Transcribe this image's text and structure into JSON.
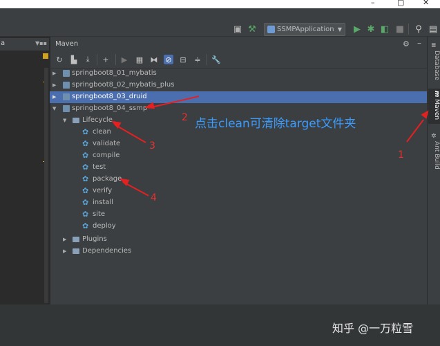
{
  "window": {
    "minimize": "–",
    "restore": "▢",
    "close": "✕"
  },
  "run_toolbar": {
    "config_name": "SSMPApplication",
    "icons": [
      "run-config-icon",
      "build-hammer-icon",
      "run-icon",
      "debug-icon",
      "coverage-icon",
      "stop-icon",
      "search-icon",
      "layout-icon"
    ]
  },
  "editor": {
    "tab_fragment": "a"
  },
  "maven": {
    "title": "Maven",
    "projects": [
      {
        "label": "springboot8_01_mybatis",
        "expanded": false
      },
      {
        "label": "springboot8_02_mybatis_plus",
        "expanded": false
      },
      {
        "label": "springboot8_03_druid",
        "expanded": false,
        "selected": true
      },
      {
        "label": "springboot8_04_ssmp",
        "expanded": true
      }
    ],
    "lifecycle_label": "Lifecycle",
    "lifecycle": [
      "clean",
      "validate",
      "compile",
      "test",
      "package",
      "verify",
      "install",
      "site",
      "deploy"
    ],
    "plugins_label": "Plugins",
    "dependencies_label": "Dependencies"
  },
  "right_tabs": {
    "database": "Database",
    "maven": "Maven",
    "ant": "Ant Build"
  },
  "annotations": {
    "n1": "1",
    "n2": "2",
    "n3": "3",
    "n4": "4",
    "caption": "点击clean可清除target文件夹",
    "arrow_color": "#e62020"
  },
  "watermark": "知乎 @一万粒雪"
}
